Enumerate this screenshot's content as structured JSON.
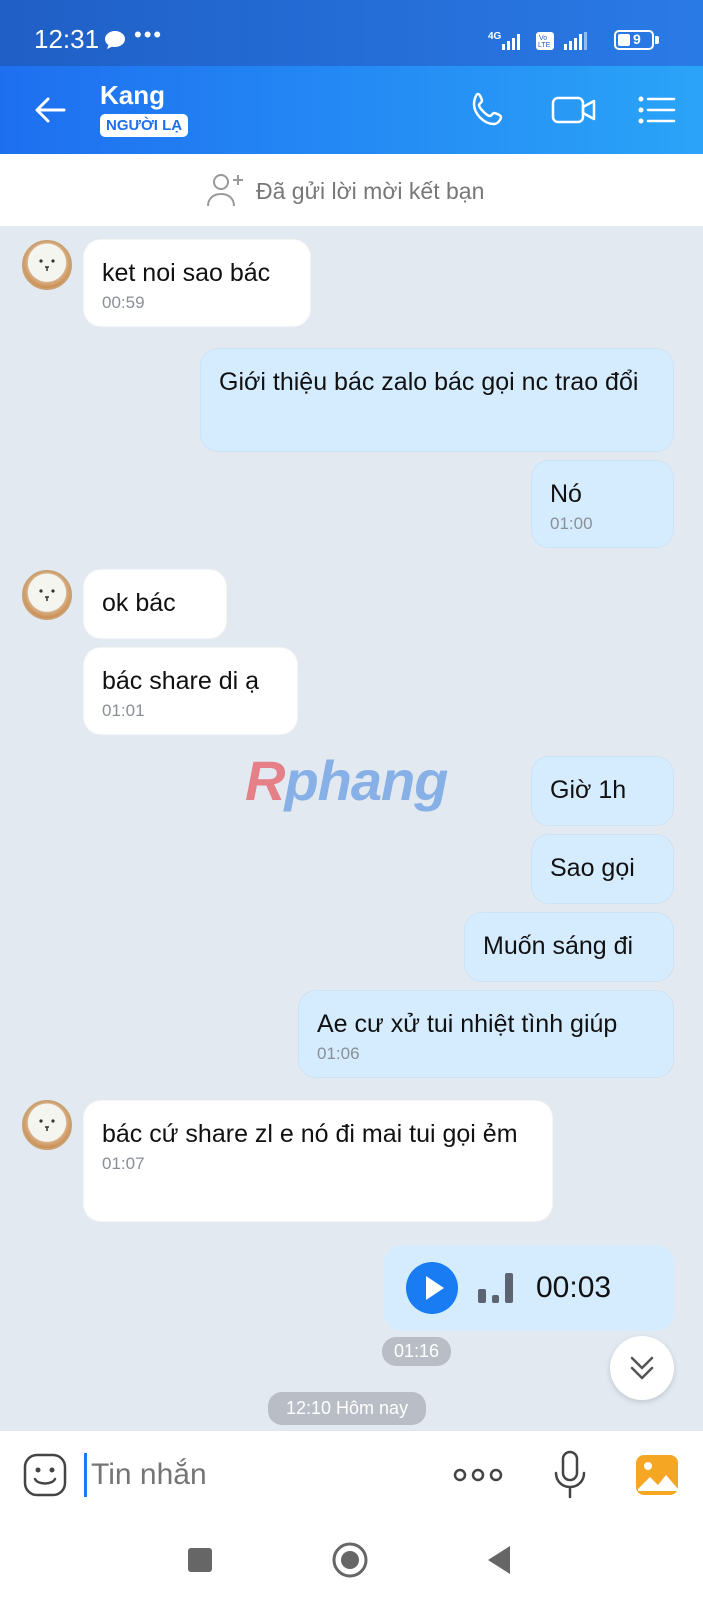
{
  "status_bar": {
    "time": "12:31",
    "dots": "•••",
    "network": "4G",
    "volte": "Vo LTE",
    "battery": "9"
  },
  "header": {
    "contact_name": "Kang",
    "badge": "NGƯỜI LẠ"
  },
  "friend_request": {
    "text": "Đã gửi lời mời kết bạn"
  },
  "messages": [
    {
      "dir": "in",
      "text": "ket noi sao bác",
      "time": "00:59"
    },
    {
      "dir": "out",
      "text": "Giới thiệu bác zalo bác gọi nc trao đổi"
    },
    {
      "dir": "out",
      "text": "Nó",
      "time": "01:00"
    },
    {
      "dir": "in",
      "text": "ok bác"
    },
    {
      "dir": "in",
      "text": "bác share di ạ",
      "time": "01:01"
    },
    {
      "dir": "out",
      "text": "Giờ 1h"
    },
    {
      "dir": "out",
      "text": "Sao gọi"
    },
    {
      "dir": "out",
      "text": "Muốn sáng đi"
    },
    {
      "dir": "out",
      "text": "Ae cư xử tui nhiệt tình giúp",
      "time": "01:06"
    },
    {
      "dir": "in",
      "text": "bác cứ share zl e nó đi mai tui gọi ẻm",
      "time": "01:07"
    }
  ],
  "voice_message": {
    "duration": "00:03",
    "time": "01:16"
  },
  "watermark": {
    "part1": "R",
    "part2": "phang"
  },
  "date_separator": "12:10 Hôm nay",
  "composer": {
    "placeholder": "Tin nhắn"
  },
  "colors": {
    "header": "#1e6ff0",
    "outgoing_bubble": "#d5ecff",
    "incoming_bubble": "#ffffff",
    "chat_bg": "#e2e9f1",
    "accent": "#1a7cf2"
  }
}
